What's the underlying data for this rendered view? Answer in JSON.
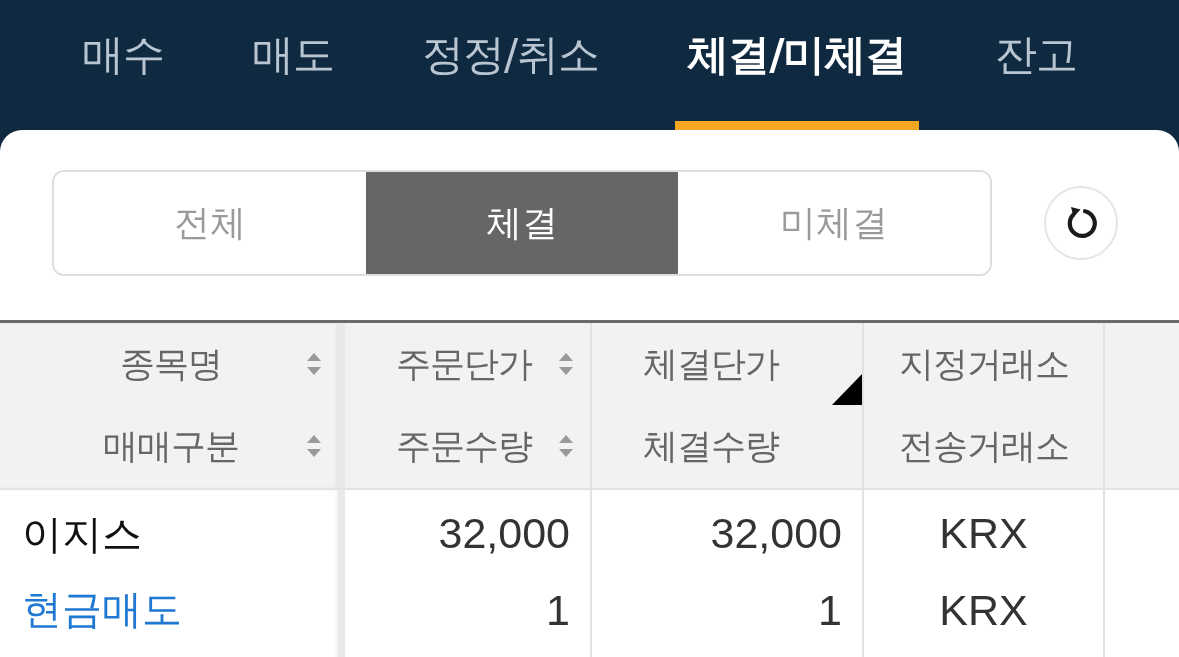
{
  "tabs": [
    {
      "label": "매수",
      "selected": false
    },
    {
      "label": "매도",
      "selected": false
    },
    {
      "label": "정정/취소",
      "selected": false
    },
    {
      "label": "체결/미체결",
      "selected": true
    },
    {
      "label": "잔고",
      "selected": false
    }
  ],
  "filter": {
    "options": [
      {
        "label": "전체",
        "selected": false
      },
      {
        "label": "체결",
        "selected": true
      },
      {
        "label": "미체결",
        "selected": false
      }
    ]
  },
  "table": {
    "columns": [
      {
        "lines": [
          {
            "label": "종목명",
            "sortable": true
          },
          {
            "label": "매매구분",
            "sortable": true
          }
        ],
        "corner_mark": false
      },
      {
        "lines": [
          {
            "label": "주문단가",
            "sortable": true
          },
          {
            "label": "주문수량",
            "sortable": true
          }
        ],
        "corner_mark": false
      },
      {
        "lines": [
          {
            "label": "체결단가",
            "sortable": false
          },
          {
            "label": "체결수량",
            "sortable": false
          }
        ],
        "corner_mark": true
      },
      {
        "lines": [
          {
            "label": "지정거래소",
            "sortable": false
          },
          {
            "label": "전송거래소",
            "sortable": false
          }
        ],
        "corner_mark": false
      }
    ],
    "rows": [
      {
        "stock": "이지스",
        "trade_type": {
          "label": "현금매도",
          "kind": "sell"
        },
        "order_price": "32,000",
        "order_qty": "1",
        "fill_price": "32,000",
        "fill_qty": "1",
        "designated_exchange": "KRX",
        "sent_exchange": "KRX"
      }
    ]
  }
}
